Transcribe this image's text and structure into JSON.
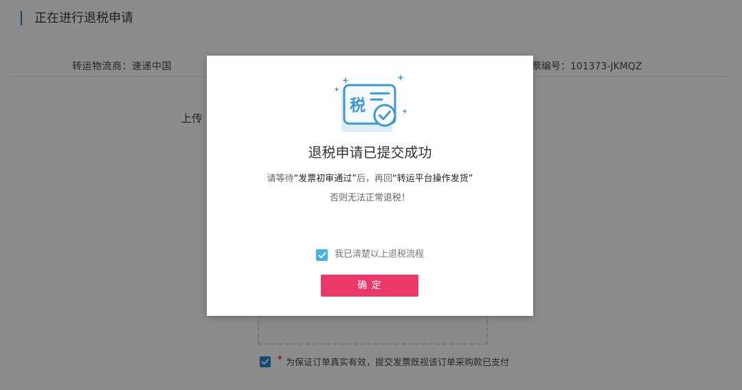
{
  "background_page": {
    "title": "正在进行退税申请",
    "shipping_carrier": "转运物流商：速递中国",
    "invoice_number": "票编号：101373-JKMQZ",
    "upload_label": "上传",
    "agreement": {
      "checked": true,
      "required_mark": "*",
      "text": "为保证订单真实有效，提交发票既视该订单采购款已支付"
    }
  },
  "modal": {
    "icon": "tax-success-icon",
    "icon_glyph": "税",
    "title": "退税申请已提交成功",
    "message": {
      "prefix": "请等待",
      "highlight_1": "“发票初审通过”",
      "middle": "后，再回",
      "highlight_2": "“转运平台操作发货”",
      "line2": "否则无法正常退税！"
    },
    "acknowledge": {
      "checked": true,
      "label": "我已清楚以上退税流程"
    },
    "confirm_button": "确 定"
  },
  "colors": {
    "accent_blue": "#1f7fd6",
    "agreement_checkbox": "#1a8fd4",
    "modal_checkbox": "#45b3e0",
    "confirm_button": "#eb3768",
    "required_red": "#e60012",
    "overlay": "rgba(0,0,0,0.45)"
  }
}
